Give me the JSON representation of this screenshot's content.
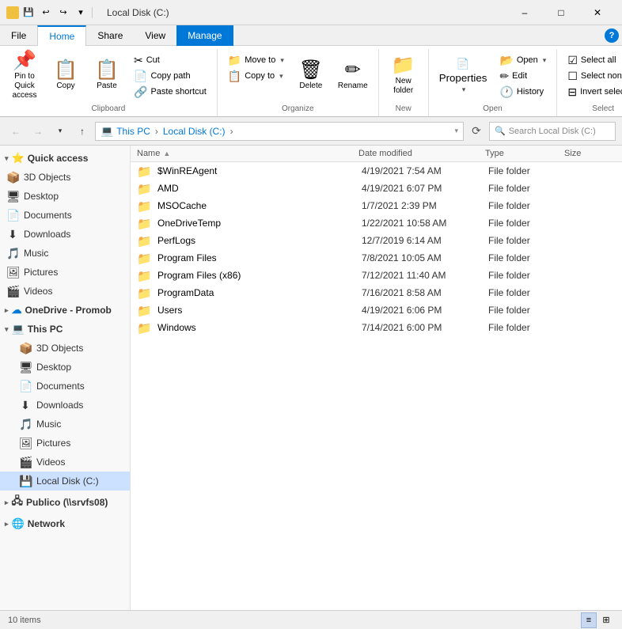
{
  "titleBar": {
    "title": "Local Disk (C:)",
    "qat": [
      "save",
      "undo",
      "redo",
      "dropdown"
    ],
    "controls": [
      "minimize",
      "maximize",
      "close"
    ]
  },
  "ribbon": {
    "tabs": [
      {
        "id": "file",
        "label": "File",
        "active": false
      },
      {
        "id": "home",
        "label": "Home",
        "active": true
      },
      {
        "id": "share",
        "label": "Share",
        "active": false
      },
      {
        "id": "view",
        "label": "View",
        "active": false
      },
      {
        "id": "manage",
        "label": "Manage",
        "active": false,
        "manage": true
      }
    ],
    "groups": {
      "clipboard": {
        "label": "Clipboard",
        "pinToQuickAccess": "Pin to Quick access",
        "copy": "Copy",
        "paste": "Paste",
        "cut": "Cut",
        "copyPath": "Copy path",
        "pasteShortcut": "Paste shortcut"
      },
      "organize": {
        "label": "Organize",
        "moveTo": "Move to",
        "copyTo": "Copy to",
        "delete": "Delete",
        "rename": "Rename"
      },
      "new": {
        "label": "New",
        "newFolder": "New folder"
      },
      "open": {
        "label": "Open",
        "open": "Open",
        "edit": "Edit",
        "history": "History",
        "properties": "Properties"
      },
      "select": {
        "label": "Select",
        "selectAll": "Select all",
        "selectNone": "Select none",
        "invertSelection": "Invert selection"
      }
    }
  },
  "addressBar": {
    "path": [
      "This PC",
      "Local Disk (C:)"
    ],
    "separator": "›",
    "searchPlaceholder": "Search Local Disk (C:)"
  },
  "sidebar": {
    "sections": [
      {
        "id": "quick-access",
        "label": "Quick access",
        "icon": "⭐",
        "expanded": true,
        "items": [
          {
            "id": "3d-objects",
            "label": "3D Objects",
            "icon": "📦"
          },
          {
            "id": "desktop",
            "label": "Desktop",
            "icon": "🖥"
          },
          {
            "id": "documents",
            "label": "Documents",
            "icon": "📄"
          },
          {
            "id": "downloads",
            "label": "Downloads",
            "icon": "⬇"
          },
          {
            "id": "music",
            "label": "Music",
            "icon": "🎵"
          },
          {
            "id": "pictures",
            "label": "Pictures",
            "icon": "🖼"
          },
          {
            "id": "videos",
            "label": "Videos",
            "icon": "🎬"
          }
        ]
      },
      {
        "id": "onedrive",
        "label": "OneDrive - Promob",
        "icon": "☁",
        "expanded": false,
        "items": []
      },
      {
        "id": "this-pc",
        "label": "This PC",
        "icon": "💻",
        "expanded": true,
        "items": [
          {
            "id": "3d-objects-pc",
            "label": "3D Objects",
            "icon": "📦"
          },
          {
            "id": "desktop-pc",
            "label": "Desktop",
            "icon": "🖥"
          },
          {
            "id": "documents-pc",
            "label": "Documents",
            "icon": "📄"
          },
          {
            "id": "downloads-pc",
            "label": "Downloads",
            "icon": "⬇"
          },
          {
            "id": "music-pc",
            "label": "Music",
            "icon": "🎵"
          },
          {
            "id": "pictures-pc",
            "label": "Pictures",
            "icon": "🖼"
          },
          {
            "id": "videos-pc",
            "label": "Videos",
            "icon": "🎬"
          },
          {
            "id": "local-disk",
            "label": "Local Disk (C:)",
            "icon": "💾",
            "selected": true
          }
        ]
      },
      {
        "id": "publico",
        "label": "Publico (\\\\srvfs08)",
        "icon": "🖧",
        "expanded": false,
        "items": []
      },
      {
        "id": "network",
        "label": "Network",
        "icon": "🌐",
        "expanded": false,
        "items": []
      }
    ]
  },
  "fileList": {
    "columns": {
      "name": "Name",
      "dateModified": "Date modified",
      "type": "Type",
      "size": "Size"
    },
    "items": [
      {
        "name": "$WinREAgent",
        "dateModified": "4/19/2021 7:54 AM",
        "type": "File folder",
        "size": ""
      },
      {
        "name": "AMD",
        "dateModified": "4/19/2021 6:07 PM",
        "type": "File folder",
        "size": ""
      },
      {
        "name": "MSOCache",
        "dateModified": "1/7/2021 2:39 PM",
        "type": "File folder",
        "size": ""
      },
      {
        "name": "OneDriveTemp",
        "dateModified": "1/22/2021 10:58 AM",
        "type": "File folder",
        "size": ""
      },
      {
        "name": "PerfLogs",
        "dateModified": "12/7/2019 6:14 AM",
        "type": "File folder",
        "size": ""
      },
      {
        "name": "Program Files",
        "dateModified": "7/8/2021 10:05 AM",
        "type": "File folder",
        "size": ""
      },
      {
        "name": "Program Files (x86)",
        "dateModified": "7/12/2021 11:40 AM",
        "type": "File folder",
        "size": ""
      },
      {
        "name": "ProgramData",
        "dateModified": "7/16/2021 8:58 AM",
        "type": "File folder",
        "size": ""
      },
      {
        "name": "Users",
        "dateModified": "4/19/2021 6:06 PM",
        "type": "File folder",
        "size": ""
      },
      {
        "name": "Windows",
        "dateModified": "7/14/2021 6:00 PM",
        "type": "File folder",
        "size": ""
      }
    ]
  },
  "statusBar": {
    "itemCount": "10 items"
  },
  "icons": {
    "back": "←",
    "forward": "→",
    "up": "↑",
    "recent": "▾",
    "refresh": "⟳",
    "search": "🔍",
    "folder": "📁",
    "cut": "✂",
    "copy": "📋",
    "paste": "📋",
    "delete": "🗑",
    "rename": "✏",
    "newFolder": "📁",
    "properties": "📄",
    "history": "🕐",
    "open": "📂",
    "sortArrow": "▲",
    "listView": "☰",
    "detailView": "≡",
    "minimize": "–",
    "maximize": "□",
    "close": "✕",
    "chevronDown": "▾",
    "chevronRight": "›",
    "expandArrow": "▸"
  }
}
